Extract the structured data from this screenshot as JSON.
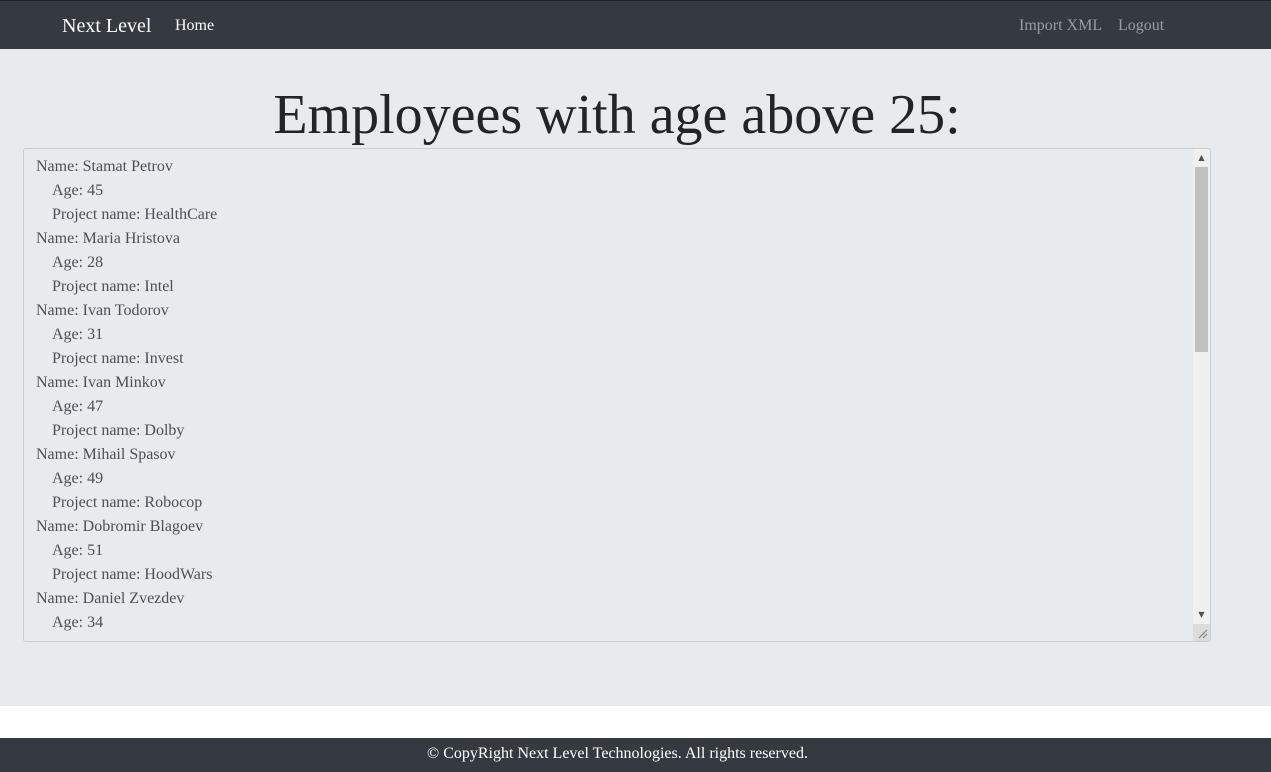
{
  "navbar": {
    "brand": "Next Level",
    "home_label": "Home",
    "import_label": "Import XML",
    "logout_label": "Logout"
  },
  "main": {
    "title": "Employees with age above 25:",
    "lines": [
      {
        "text": "Name: Stamat Petrov",
        "indent": false
      },
      {
        "text": "Age: 45",
        "indent": true
      },
      {
        "text": "Project name: HealthCare",
        "indent": true
      },
      {
        "text": "Name: Maria Hristova",
        "indent": false
      },
      {
        "text": "Age: 28",
        "indent": true
      },
      {
        "text": "Project name: Intel",
        "indent": true
      },
      {
        "text": "Name: Ivan Todorov",
        "indent": false
      },
      {
        "text": "Age: 31",
        "indent": true
      },
      {
        "text": "Project name: Invest",
        "indent": true
      },
      {
        "text": "Name: Ivan Minkov",
        "indent": false
      },
      {
        "text": "Age: 47",
        "indent": true
      },
      {
        "text": "Project name: Dolby",
        "indent": true
      },
      {
        "text": "Name: Mihail Spasov",
        "indent": false
      },
      {
        "text": "Age: 49",
        "indent": true
      },
      {
        "text": "Project name: Robocop",
        "indent": true
      },
      {
        "text": "Name: Dobromir Blagoev",
        "indent": false
      },
      {
        "text": "Age: 51",
        "indent": true
      },
      {
        "text": "Project name: HoodWars",
        "indent": true
      },
      {
        "text": "Name: Daniel Zvezdev",
        "indent": false
      },
      {
        "text": "Age: 34",
        "indent": true
      }
    ]
  },
  "footer": {
    "text": "© CopyRight Next Level Technologies. All rights reserved."
  },
  "icons": {
    "scroll_up": "scroll-up-arrow-icon",
    "scroll_down": "scroll-down-arrow-icon",
    "resize": "resize-grip-icon"
  },
  "colors": {
    "navbar_bg": "#343a40",
    "page_bg": "#e7ebee",
    "nav_muted": "#9a9da1"
  }
}
